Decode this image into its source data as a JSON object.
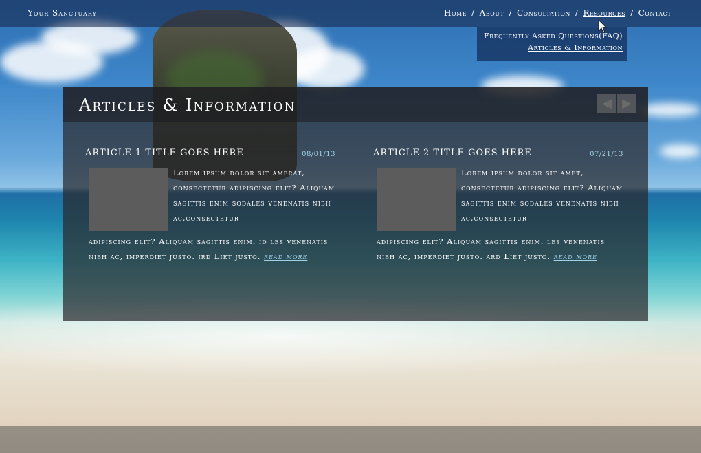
{
  "site": {
    "brand": "Your Sanctuary"
  },
  "nav": {
    "items": [
      {
        "label": "Home",
        "active": false
      },
      {
        "label": "About",
        "active": false
      },
      {
        "label": "Consultation",
        "active": false
      },
      {
        "label": "Resources",
        "active": true
      },
      {
        "label": "Contact",
        "active": false
      }
    ],
    "separator": "/"
  },
  "dropdown": {
    "items": [
      {
        "label": "Frequently Asked Questions(FAQ)"
      },
      {
        "label": "Articles & Information"
      }
    ]
  },
  "panel": {
    "title": "Articles & Information",
    "prev_icon": "◀",
    "next_icon": "▶"
  },
  "articles": [
    {
      "title": "Article 1 title goes here",
      "date": "08/01/13",
      "body_top": "Lorem ipsum dolor sit amerat, consectetur adipiscing elit? Aliquam sagittis enim sodales venenatis nibh ac,consectetur",
      "body_bottom": "adipiscing elit? Aliquam  sagittis enim. id les venenatis nibh ac, imperdiet justo. ird Liet justo.",
      "read_more": "read more"
    },
    {
      "title": "Article 2 title goes here",
      "date": "07/21/13",
      "body_top": "Lorem ipsum dolor sit amet, consectetur adipiscing elit? Aliquam sagittis enim sodales venenatis nibh ac,consectetur",
      "body_bottom": "adipiscing elit? Aliquam  sagittis enim. les venenatis nibh ac, imperdiet justo. ard Liet justo.",
      "read_more": "read more"
    }
  ],
  "colors": {
    "accent": "#9fd0e8",
    "panel": "#28282d",
    "topbar": "#14234a"
  }
}
